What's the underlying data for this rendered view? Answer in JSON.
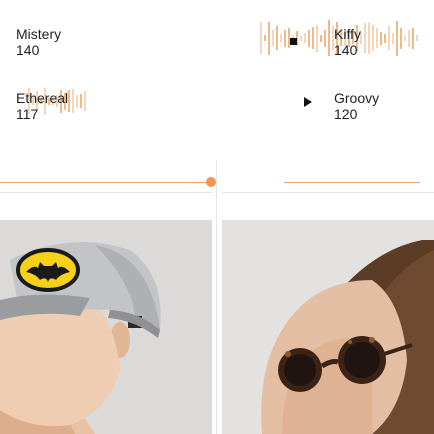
{
  "tracks": [
    {
      "name": "Mistery",
      "bpm": "140",
      "state": "idle"
    },
    {
      "name": "Kiffy",
      "bpm": "140",
      "state": "playing",
      "control_icon": "stop-icon"
    },
    {
      "name": "Ethereal",
      "bpm": "117",
      "state": "idle"
    },
    {
      "name": "Groovy",
      "bpm": "120",
      "state": "paused",
      "control_icon": "play-icon"
    }
  ],
  "sliders": [
    {
      "name": "left-slider",
      "value_fraction": 1.0
    },
    {
      "name": "right-slider",
      "value_fraction": 0.0
    }
  ],
  "images": [
    {
      "name": "batman-cap-photo",
      "subject": "man wearing Batman snapback cap"
    },
    {
      "name": "sunglasses-photo",
      "subject": "woman wearing round tortoiseshell sunglasses"
    }
  ],
  "colors": {
    "accent": "#f39551",
    "wave": "#f0b98a",
    "text": "#222222"
  }
}
